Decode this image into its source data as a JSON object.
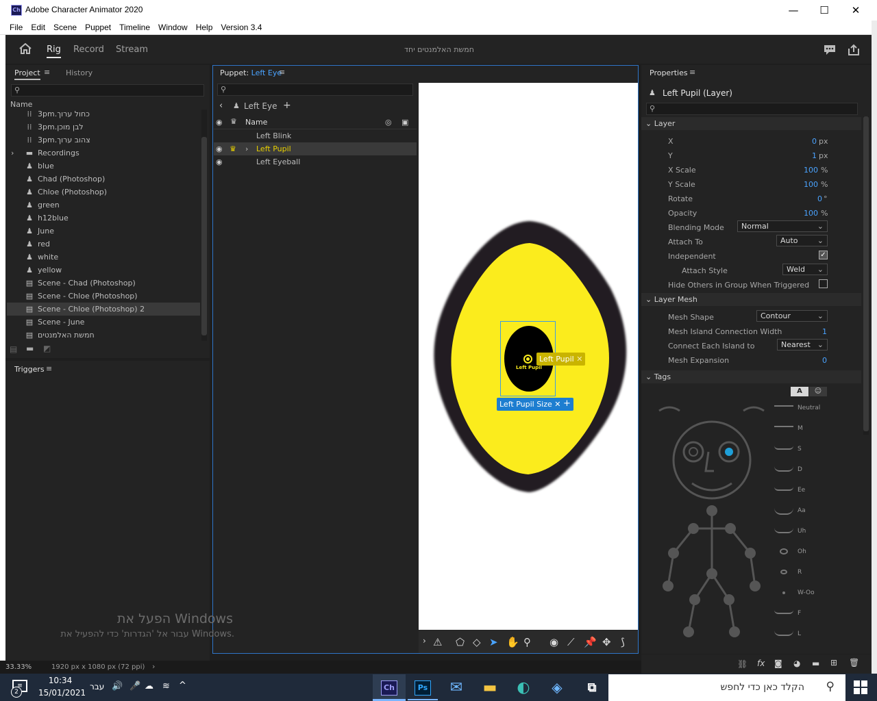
{
  "window": {
    "title": "Adobe Character Animator 2020",
    "icon": "Ch",
    "minimize": "—",
    "maximize": "☐",
    "close": "✕"
  },
  "menu": [
    "File",
    "Edit",
    "Scene",
    "Puppet",
    "Timeline",
    "Window",
    "Help",
    "Version 3.4"
  ],
  "modes": {
    "rig": "Rig",
    "record": "Record",
    "stream": "Stream"
  },
  "scene_title": "חמשת האלמנטים יחד",
  "project_panel": {
    "tab_project": "Project",
    "tab_history": "History",
    "column_name": "Name",
    "items": [
      {
        "label": "3pm.כחול ערוך",
        "icon": "audio-icon"
      },
      {
        "label": "3pm.לבן מוכן",
        "icon": "audio-icon"
      },
      {
        "label": "3pm.צהוב ערוך",
        "icon": "audio-icon"
      },
      {
        "label": "Recordings",
        "icon": "folder-icon"
      },
      {
        "label": "blue",
        "icon": "puppet-icon"
      },
      {
        "label": "Chad (Photoshop)",
        "icon": "puppet-icon"
      },
      {
        "label": "Chloe (Photoshop)",
        "icon": "puppet-icon"
      },
      {
        "label": "green",
        "icon": "puppet-icon"
      },
      {
        "label": "h12blue",
        "icon": "puppet-icon"
      },
      {
        "label": "June",
        "icon": "puppet-icon"
      },
      {
        "label": "red",
        "icon": "puppet-icon"
      },
      {
        "label": "white",
        "icon": "puppet-icon"
      },
      {
        "label": "yellow",
        "icon": "puppet-icon"
      },
      {
        "label": "Scene - Chad (Photoshop)",
        "icon": "scene-icon"
      },
      {
        "label": "Scene - Chloe (Photoshop)",
        "icon": "scene-icon"
      },
      {
        "label": "Scene - Chloe (Photoshop) 2",
        "icon": "scene-icon",
        "selected": true
      },
      {
        "label": "Scene - June",
        "icon": "scene-icon"
      },
      {
        "label": "חמשת האלמנטים",
        "icon": "scene-icon"
      }
    ]
  },
  "triggers_panel": {
    "title": "Triggers"
  },
  "puppet_panel": {
    "title_prefix": "Puppet:",
    "title_name": "Left Eye",
    "breadcrumb": "Left Eye",
    "column_name": "Name",
    "rows": [
      {
        "label": "Left Blink"
      },
      {
        "label": "Left Pupil",
        "selected": true
      },
      {
        "label": "Left Eyeball"
      }
    ]
  },
  "canvas": {
    "handle_label": "Left Pupil",
    "pupil_text": "Left Pupil",
    "tag_label": "Left Pupil Size",
    "add": "+"
  },
  "properties": {
    "title": "Properties",
    "layer_name": "Left Pupil (Layer)",
    "sections": {
      "layer": "Layer",
      "mesh": "Layer Mesh",
      "tags": "Tags"
    },
    "x": {
      "label": "X",
      "value": "0",
      "unit": "px"
    },
    "y": {
      "label": "Y",
      "value": "1",
      "unit": "px"
    },
    "xscale": {
      "label": "X Scale",
      "value": "100",
      "unit": "%"
    },
    "yscale": {
      "label": "Y Scale",
      "value": "100",
      "unit": "%"
    },
    "rotate": {
      "label": "Rotate",
      "value": "0",
      "unit": "°"
    },
    "opacity": {
      "label": "Opacity",
      "value": "100",
      "unit": "%"
    },
    "blending": {
      "label": "Blending Mode",
      "value": "Normal"
    },
    "attach_to": {
      "label": "Attach To",
      "value": "Auto"
    },
    "independent": {
      "label": "Independent",
      "checked": true
    },
    "attach_style": {
      "label": "Attach Style",
      "value": "Weld"
    },
    "hide_others": {
      "label": "Hide Others in Group When Triggered",
      "checked": false
    },
    "mesh_shape": {
      "label": "Mesh Shape",
      "value": "Contour"
    },
    "mesh_island": {
      "label": "Mesh Island Connection Width",
      "value": "1"
    },
    "connect_island": {
      "label": "Connect Each Island to",
      "value": "Nearest"
    },
    "mesh_expansion": {
      "label": "Mesh Expansion",
      "value": "0"
    },
    "tag_toggle_a": "A",
    "visemes": [
      "Neutral",
      "M",
      "S",
      "D",
      "Ee",
      "Aa",
      "Uh",
      "Oh",
      "R",
      "W-Oo",
      "F",
      "L"
    ]
  },
  "watermark": {
    "line1": "הפעל את Windows",
    "line2": "עבור אל 'הגדרות' כדי להפעיל את Windows."
  },
  "statusbar": {
    "zoom": "33.33%",
    "dimensions": "1920 px x 1080 px (72 ppi)"
  },
  "taskbar": {
    "time": "10:34",
    "date": "15/01/2021",
    "lang": "עבר",
    "search_placeholder": "הקלד כאן כדי לחפש",
    "notification_count": "2",
    "apps": [
      "Ch",
      "Ps"
    ]
  }
}
